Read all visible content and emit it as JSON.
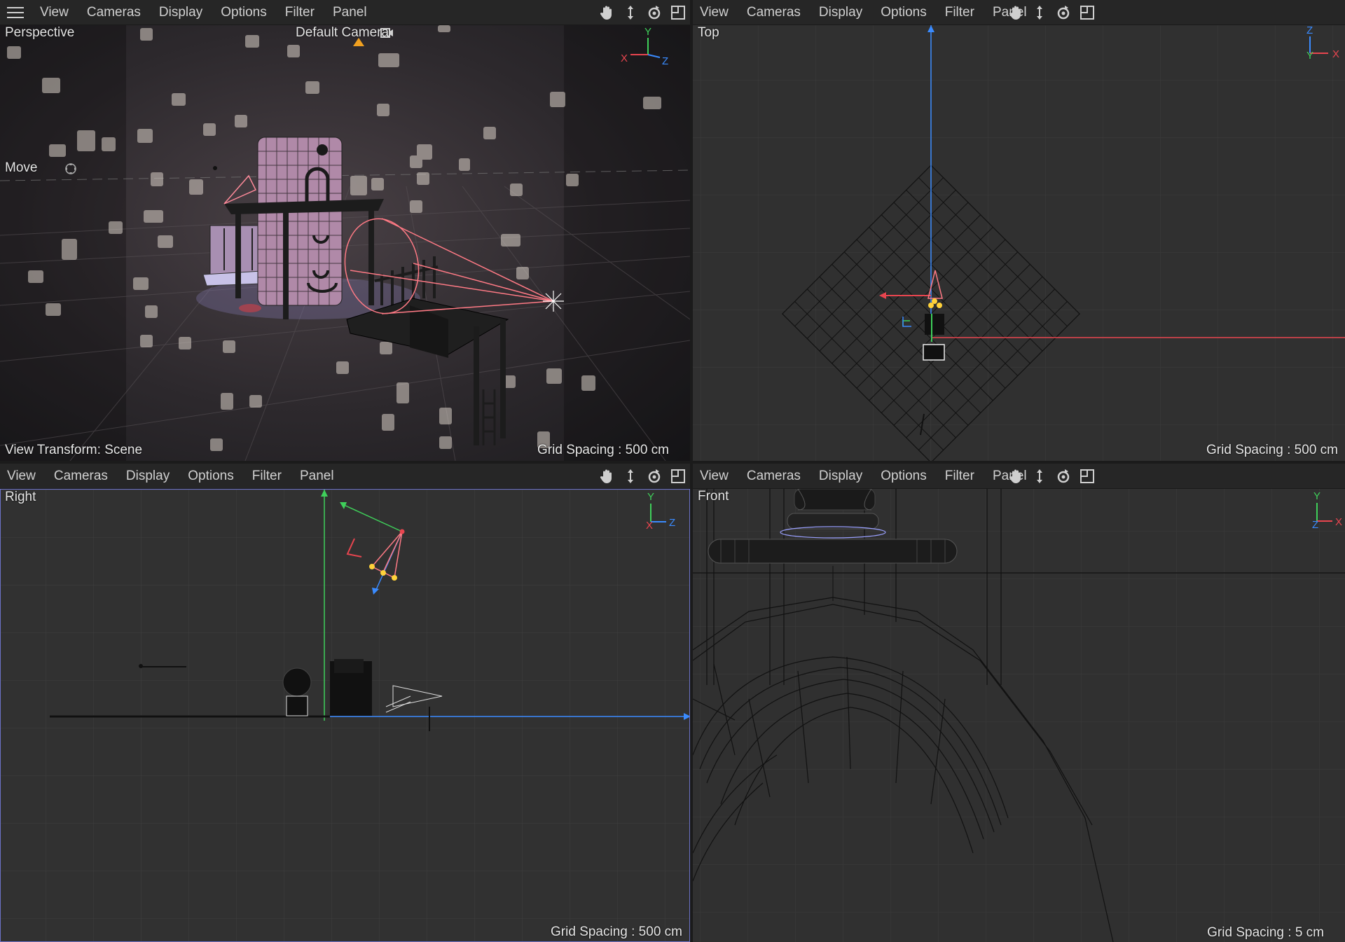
{
  "menus": [
    "View",
    "Cameras",
    "Display",
    "Options",
    "Filter",
    "Panel"
  ],
  "toolbar_icons": [
    "pan-icon",
    "move-view-icon",
    "rotate-view-icon",
    "maximize-view-icon"
  ],
  "perspective": {
    "view_name": "Perspective",
    "camera_label": "Default Camera",
    "tool_label": "Move",
    "view_transform": "View Transform: Scene",
    "grid_spacing": "Grid Spacing : 500 cm",
    "axes": {
      "y": "Y",
      "x": "X",
      "z": "Z"
    }
  },
  "top": {
    "view_name": "Top",
    "grid_spacing": "Grid Spacing : 500 cm",
    "axes": {
      "a": "Z",
      "b": "Y",
      "c": "X"
    }
  },
  "right": {
    "view_name": "Right",
    "grid_spacing": "Grid Spacing : 500 cm",
    "axes": {
      "y": "Y",
      "x": "X",
      "z": "Z"
    }
  },
  "front": {
    "view_name": "Front",
    "grid_spacing": "Grid Spacing : 5 cm",
    "axes": {
      "y": "Y",
      "z": "Z",
      "x": "X"
    }
  },
  "colors": {
    "axis_x": "#e8454f",
    "axis_y": "#3fcf5a",
    "axis_z": "#3a8bff",
    "active_border": "#6c72c8",
    "light_cone": "#ff7a85"
  }
}
